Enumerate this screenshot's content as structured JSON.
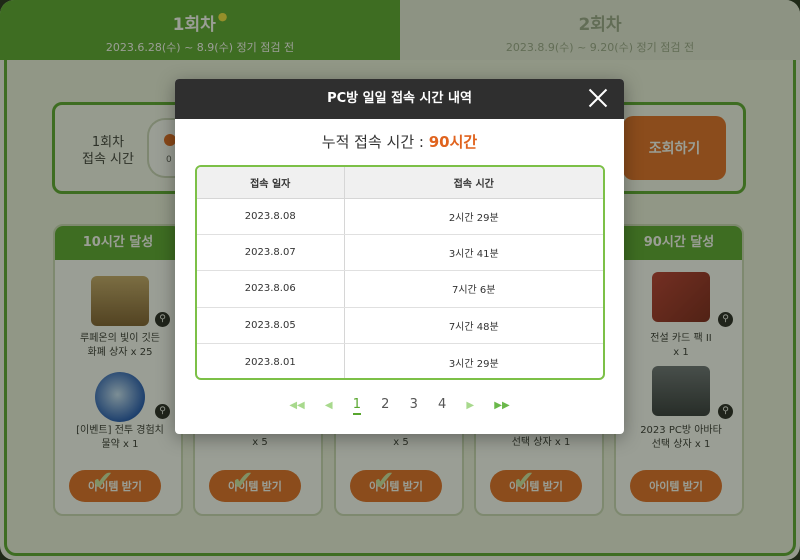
{
  "tabs": [
    {
      "title": "1회차",
      "subtitle": "2023.6.28(수) ~ 8.9(수) 정기 점검 전"
    },
    {
      "title": "2회차",
      "subtitle": "2023.8.9(수) ~ 9.20(수) 정기 점검 전"
    }
  ],
  "session": {
    "label": "1회차\n접속 시간",
    "progress_start": "0",
    "query_button": "조회하기"
  },
  "cards": [
    {
      "heading": "10시간 달성",
      "item1": "루페온의 빛이 깃든\n화폐 상자 x 25",
      "item2": "[이벤트] 전투 경험치\n물약 x 1",
      "button": "아이템 받기"
    },
    {
      "item2": "x 5",
      "button": "아이템 받기"
    },
    {
      "item2": "x 5",
      "button": "아이템 받기"
    },
    {
      "item2": "선택 상자 x 1",
      "button": "아이템 받기"
    },
    {
      "heading": "90시간 달성",
      "item1": "전설 카드 팩 II\nx 1",
      "item2": "2023 PC방 아바타\n선택 상자 x 1",
      "button": "아이템 받기"
    }
  ],
  "modal": {
    "title": "PC방 일일 접속 시간 내역",
    "total_label": "누적 접속 시간 : ",
    "total_value": "90시간",
    "headers": [
      "접속 일자",
      "접속 시간"
    ],
    "rows": [
      [
        "2023.8.08",
        "2시간 29분"
      ],
      [
        "2023.8.07",
        "3시간 41분"
      ],
      [
        "2023.8.06",
        "7시간 6분"
      ],
      [
        "2023.8.05",
        "7시간 48분"
      ],
      [
        "2023.8.01",
        "3시간 29분"
      ]
    ],
    "pages": [
      "1",
      "2",
      "3",
      "4"
    ],
    "current_page": "1"
  },
  "icons": {
    "first": "double-left-arrow-icon",
    "prev": "left-arrow-icon",
    "next": "right-arrow-icon",
    "last": "double-right-arrow-icon",
    "close": "close-icon",
    "zoom": "magnifier-icon"
  },
  "colors": {
    "brand_green": "#58a62e",
    "accent_orange": "#e46a23",
    "highlight_orange": "#e0631e"
  }
}
